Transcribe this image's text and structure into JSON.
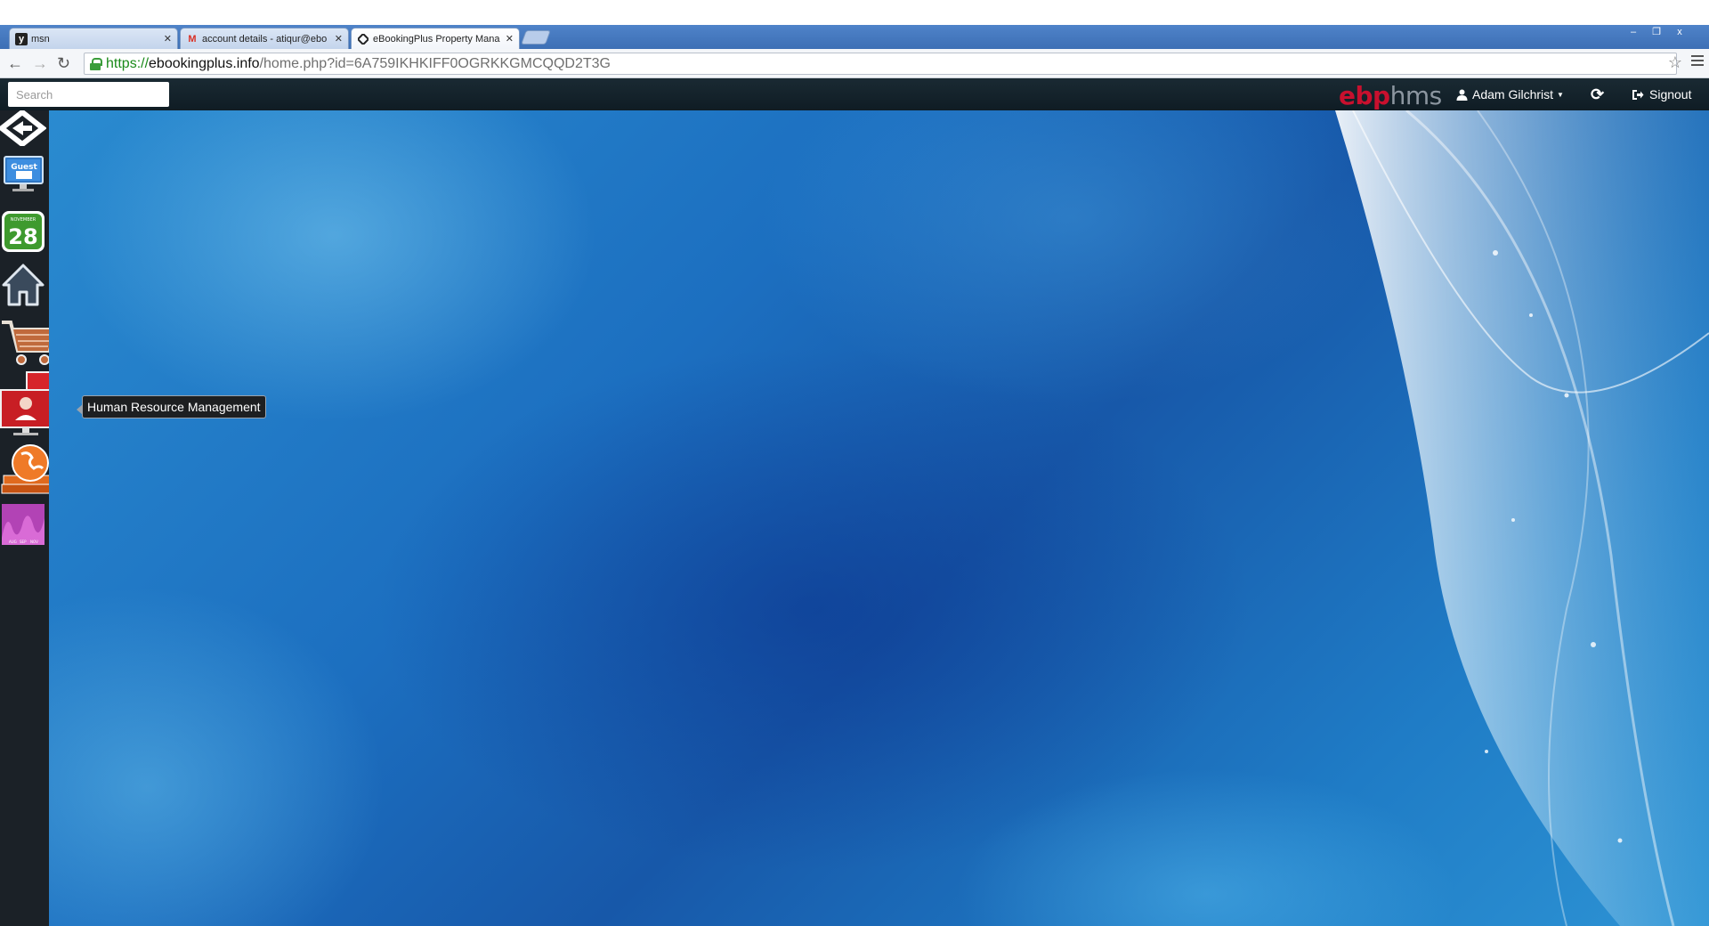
{
  "browser": {
    "tabs": [
      {
        "label": "msn",
        "favicon": "y"
      },
      {
        "label": "account details - atiqur@ebo",
        "favicon": "M"
      },
      {
        "label": "eBookingPlus Property Mana",
        "favicon": "ebp"
      }
    ],
    "url": {
      "scheme": "https://",
      "host": "ebookingplus.info",
      "path": "/home.php?id=6A759IKHKIFF0OGRKKGMCQQD2T3G"
    },
    "window_controls": [
      "–",
      "❐",
      "x"
    ]
  },
  "header": {
    "search_placeholder": "Search",
    "brand_part1": "ebp",
    "brand_part2": "hms",
    "user_name": "Adam Gilchrist",
    "refresh_glyph": "⟳",
    "signout_label": "Signout"
  },
  "sidebar": {
    "items": [
      {
        "name": "ebp-logo",
        "icon": "logo-arrow-icon"
      },
      {
        "name": "guest",
        "icon": "guest-monitor-icon",
        "text": "Guest"
      },
      {
        "name": "calendar",
        "icon": "calendar-icon",
        "month": "NOVEMBER",
        "day": "28"
      },
      {
        "name": "home",
        "icon": "house-icon"
      },
      {
        "name": "shopping",
        "icon": "shopping-cart-icon"
      },
      {
        "name": "human-resource",
        "icon": "hr-monitors-icon"
      },
      {
        "name": "travel",
        "icon": "globe-books-icon"
      },
      {
        "name": "reports",
        "icon": "pink-wave-chart-icon",
        "labels": [
          "AUG",
          "SEP",
          "NOV"
        ]
      }
    ],
    "tooltip": "Human Resource Management"
  },
  "colors": {
    "brand_red": "#c8102e",
    "appbar": "#13222b",
    "sidebar": "#1b2127",
    "desktop_blue": "#1c6fc0"
  }
}
